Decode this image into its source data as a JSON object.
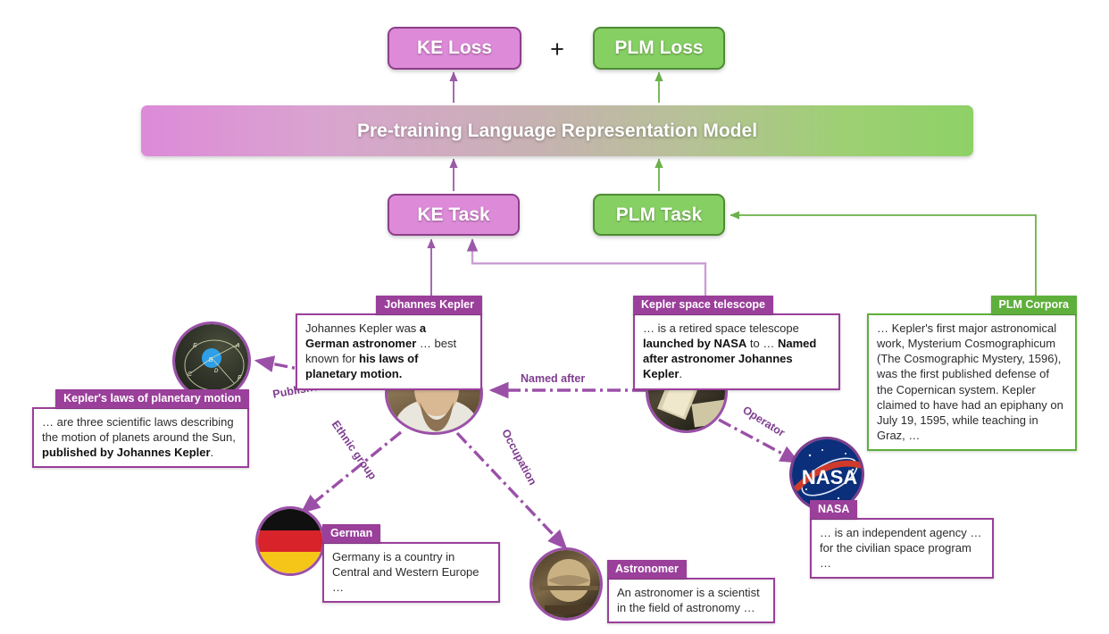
{
  "figure": {
    "losses": {
      "ke_loss": "KE Loss",
      "plus": "+",
      "plm_loss": "PLM Loss"
    },
    "model_bar": "Pre-training Language Representation Model",
    "tasks": {
      "ke_task": "KE Task",
      "plm_task": "PLM Task"
    },
    "colors": {
      "ke_purple_fill": "#dd8ad8",
      "ke_purple_border": "#8d3f8a",
      "plm_green_fill": "#86cf63",
      "plm_green_border": "#4d8c33",
      "tag_purple": "#9a3f9a",
      "tag_green": "#5faf3c",
      "edge_purple": "#9b50a8",
      "node_ring": "#9b50a8"
    },
    "cards": [
      {
        "id": "johannes-kepler",
        "tag": "Johannes Kepler",
        "text_parts": [
          {
            "t": "Johannes Kepler was ",
            "b": false
          },
          {
            "t": "a German astronomer",
            "b": true
          },
          {
            "t": " … best known for ",
            "b": false
          },
          {
            "t": "his laws of planetary motion.",
            "b": true
          }
        ]
      },
      {
        "id": "kepler-space-telescope",
        "tag": "Kepler space telescope",
        "text_parts": [
          {
            "t": "… is a retired space telescope ",
            "b": false
          },
          {
            "t": "launched by NASA",
            "b": true
          },
          {
            "t": " to … ",
            "b": false
          },
          {
            "t": "Named after astronomer Johannes Kepler",
            "b": true
          },
          {
            "t": ".",
            "b": false
          }
        ]
      },
      {
        "id": "plm-corpora",
        "tag": "PLM Corpora",
        "text_parts": [
          {
            "t": "… Kepler's first major astronomical work, Mysterium Cosmographicum (The Cosmographic Mystery, 1596), was the first published defense of the Copernican system. Kepler claimed to have had an epiphany on July 19, 1595, while teaching in Graz, …",
            "b": false
          }
        ]
      },
      {
        "id": "keplers-laws",
        "tag": "Kepler's laws of planetary motion",
        "text_parts": [
          {
            "t": "… are three scientific laws describing the motion of planets around the Sun, ",
            "b": false
          },
          {
            "t": "published by Johannes Kepler",
            "b": true
          },
          {
            "t": ".",
            "b": false
          }
        ]
      },
      {
        "id": "german",
        "tag": "German",
        "text_parts": [
          {
            "t": "Germany is a country in Central and Western Europe …",
            "b": false
          }
        ]
      },
      {
        "id": "astronomer",
        "tag": "Astronomer",
        "text_parts": [
          {
            "t": "An astronomer is a scientist in the field of astronomy …",
            "b": false
          }
        ]
      },
      {
        "id": "nasa",
        "tag": "NASA",
        "text_parts": [
          {
            "t": "… is an independent agency … for the civilian space program …",
            "b": false
          }
        ]
      }
    ],
    "relations": [
      {
        "id": "published-by",
        "label": "Published by"
      },
      {
        "id": "named-after",
        "label": "Named after"
      },
      {
        "id": "ethnic-group",
        "label": "Ethnic group"
      },
      {
        "id": "occupation",
        "label": "Occupation"
      },
      {
        "id": "operator",
        "label": "Operator"
      }
    ],
    "nodes": [
      {
        "id": "orbit-diagram-node",
        "depicts": "planetary-orbit-diagram-image"
      },
      {
        "id": "kepler-portrait-node",
        "depicts": "johannes-kepler-portrait-image"
      },
      {
        "id": "telescope-node",
        "depicts": "kepler-space-telescope-image"
      },
      {
        "id": "german-flag-node",
        "depicts": "german-flag-image"
      },
      {
        "id": "globe-node",
        "depicts": "antique-globe-image"
      },
      {
        "id": "nasa-logo-node",
        "depicts": "nasa-logo-image"
      }
    ]
  }
}
